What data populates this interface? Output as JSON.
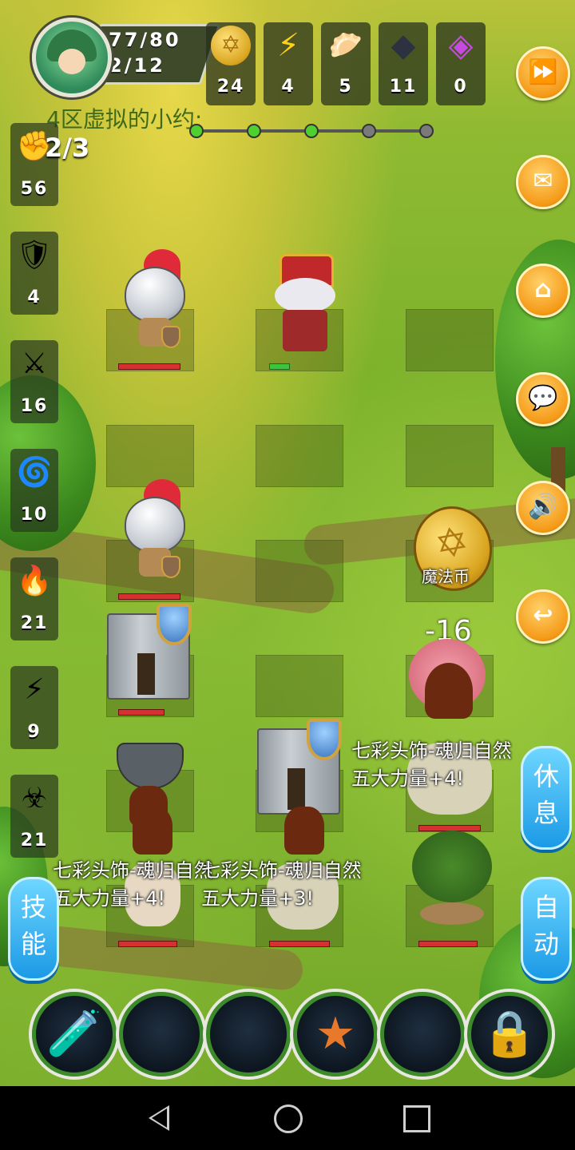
{
  "hero": {
    "hp": "77/80",
    "level": "2/12"
  },
  "resources": [
    {
      "icon": "gold-coin-icon",
      "glyph": "✡",
      "value": "24"
    },
    {
      "icon": "lightning-icon",
      "glyph": "⚡",
      "value": "4"
    },
    {
      "icon": "bread-icon",
      "glyph": "🥟",
      "value": "5"
    },
    {
      "icon": "iron-ingot-icon",
      "glyph": "◆",
      "value": "11"
    },
    {
      "icon": "crystal-icon",
      "glyph": "◈",
      "value": "0"
    }
  ],
  "server_name": "4区虚拟的小约:",
  "wave": "2/3",
  "wave_progress": {
    "reached": 3,
    "total": 5
  },
  "left_stats": [
    {
      "icon": "fist-icon",
      "glyph": "✊",
      "value": "56"
    },
    {
      "icon": "shield-icon",
      "glyph": "🛡",
      "value": "4"
    },
    {
      "icon": "holy-sword-icon",
      "glyph": "⚔",
      "value": "16"
    },
    {
      "icon": "water-icon",
      "glyph": "🌀",
      "value": "10"
    },
    {
      "icon": "fire-icon",
      "glyph": "🔥",
      "value": "21"
    },
    {
      "icon": "lightning-bolt-icon",
      "glyph": "⚡",
      "value": "9"
    },
    {
      "icon": "poison-icon",
      "glyph": "☣",
      "value": "21"
    }
  ],
  "right_buttons": [
    {
      "name": "fast-forward-button",
      "icon": "fast-forward-icon",
      "glyph": "⏩"
    },
    {
      "name": "mail-button",
      "icon": "mail-icon",
      "glyph": "✉"
    },
    {
      "name": "home-button",
      "icon": "home-icon",
      "glyph": "⌂"
    },
    {
      "name": "chat-button",
      "icon": "chat-icon",
      "glyph": "💬"
    },
    {
      "name": "sound-button",
      "icon": "speaker-icon",
      "glyph": "🔊"
    },
    {
      "name": "back-button",
      "icon": "undo-icon",
      "glyph": "↩"
    }
  ],
  "board": {
    "coin_label": "魔法币",
    "damage": "-16",
    "drop_texts": [
      {
        "line1": "七彩头饰-魂归自然",
        "line2": "五大力量+4!"
      },
      {
        "line1": "七彩头饰-魂归自然",
        "line2": "五大力量+4!"
      },
      {
        "line1": "七彩头饰-魂归自然",
        "line2": "五大力量+3!"
      }
    ]
  },
  "side_tabs": {
    "rest": [
      "休",
      "息"
    ],
    "skill": [
      "技",
      "能"
    ],
    "auto": [
      "自",
      "动"
    ]
  },
  "item_slots": [
    {
      "icon": "potion-icon",
      "glyph": "🧪"
    },
    {
      "icon": "empty-slot-icon",
      "glyph": ""
    },
    {
      "icon": "empty-slot-icon",
      "glyph": ""
    },
    {
      "icon": "star-icon",
      "glyph": "★"
    },
    {
      "icon": "empty-slot-icon",
      "glyph": ""
    },
    {
      "icon": "lock-icon",
      "glyph": "🔒"
    }
  ]
}
